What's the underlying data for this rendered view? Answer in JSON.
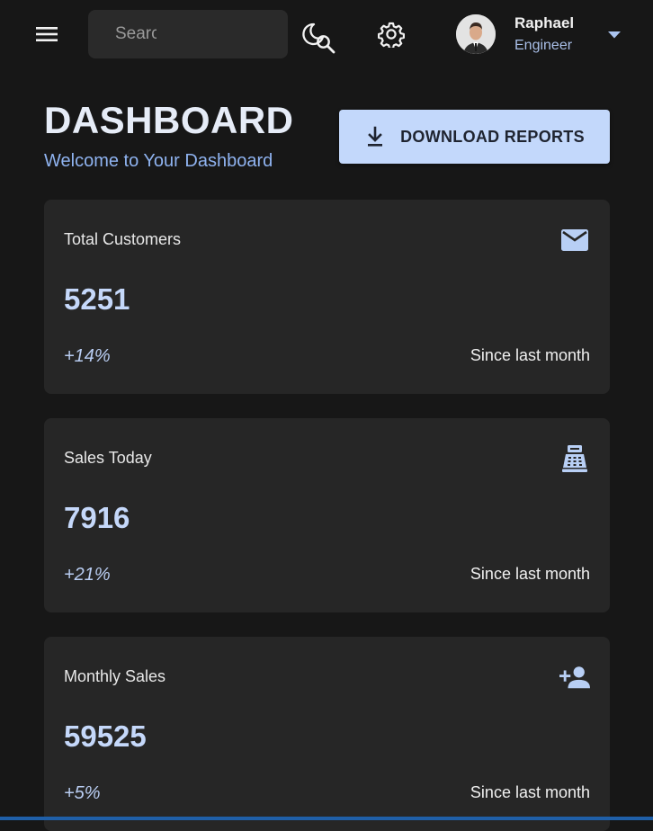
{
  "topbar": {
    "search_placeholder": "Search",
    "user": {
      "name": "Raphael",
      "role": "Engineer"
    }
  },
  "header": {
    "title": "DASHBOARD",
    "subtitle": "Welcome to Your Dashboard",
    "download_label": "DOWNLOAD REPORTS"
  },
  "cards": [
    {
      "title": "Total Customers",
      "value": "5251",
      "change": "+14%",
      "note": "Since last month",
      "icon": "email-icon"
    },
    {
      "title": "Sales Today",
      "value": "7916",
      "change": "+21%",
      "note": "Since last month",
      "icon": "point-of-sale-icon"
    },
    {
      "title": "Monthly Sales",
      "value": "59525",
      "change": "+5%",
      "note": "Since last month",
      "icon": "person-add-icon"
    }
  ],
  "colors": {
    "accent": "#c3d8fb",
    "value_text": "#c5d8fa",
    "card_bg": "#262626",
    "page_bg": "#171717"
  }
}
